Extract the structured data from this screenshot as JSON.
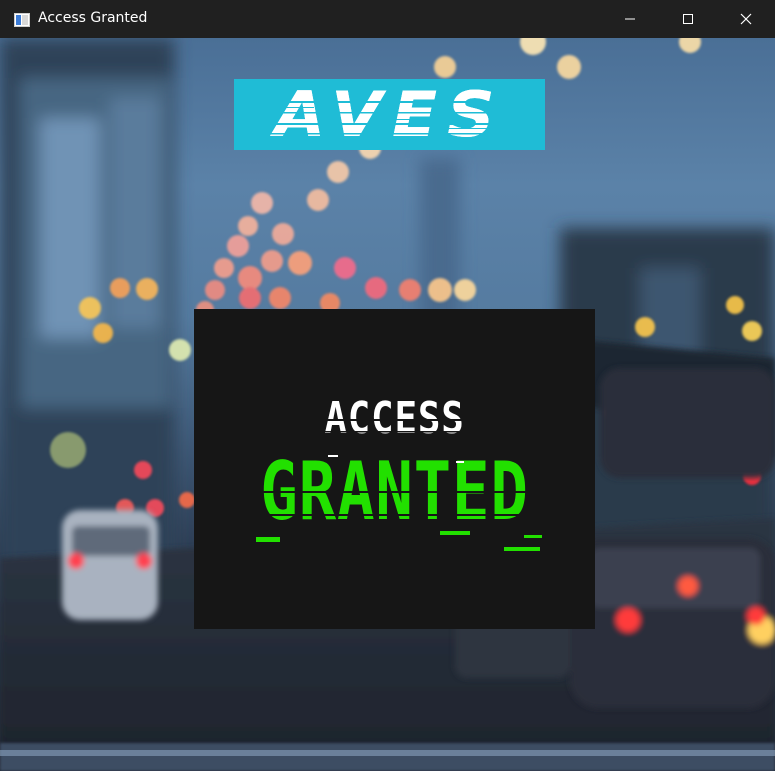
{
  "window": {
    "title": "Access Granted",
    "icon": "app-window-icon",
    "controls": {
      "minimize_icon": "minimize-icon",
      "maximize_icon": "maximize-icon",
      "close_icon": "close-icon"
    }
  },
  "logo": {
    "text": "AVES",
    "background": "#1fbcd6",
    "color": "#ffffff"
  },
  "status": {
    "line1": "ACCESS",
    "line2": "GRANTED",
    "line1_color": "#ffffff",
    "line2_color": "#22e000",
    "panel_color": "#161616"
  }
}
